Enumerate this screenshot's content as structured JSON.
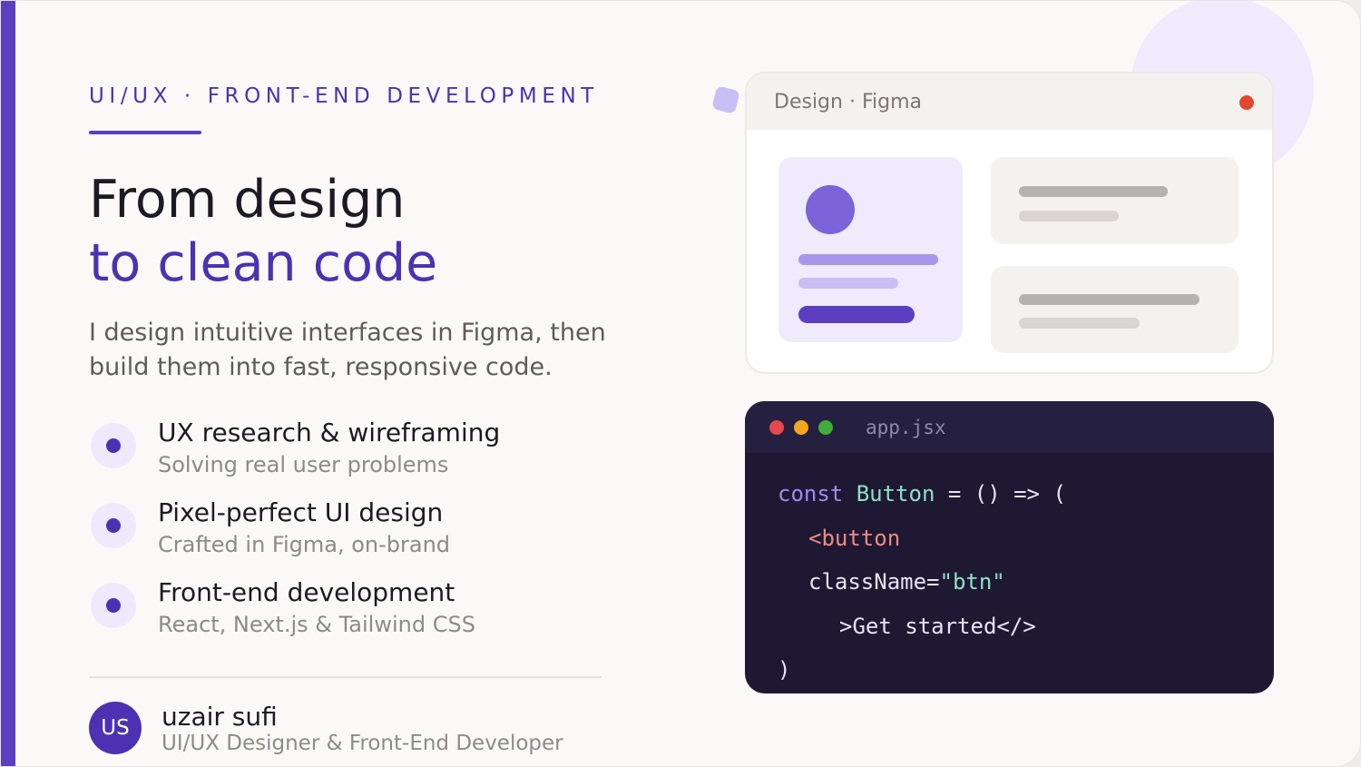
{
  "colors": {
    "accent": "#5b3fc0",
    "accent_text": "#4a32b3",
    "card_background": "#fbf9f8",
    "code_background": "#1e1832",
    "record_dot": "#e0492e"
  },
  "hero": {
    "eyebrow": "UI/UX · FRONT-END DEVELOPMENT",
    "title_line1": "From design",
    "title_line2": "to clean code",
    "lead": "I design intuitive interfaces in Figma, then build them into fast, responsive code."
  },
  "features": [
    {
      "title": "UX research & wireframing",
      "subtitle": "Solving real user problems",
      "icon": "bullet-dot-icon"
    },
    {
      "title": "Pixel-perfect UI design",
      "subtitle": "Crafted in Figma, on-brand",
      "icon": "bullet-dot-icon"
    },
    {
      "title": "Front-end development",
      "subtitle": "React, Next.js & Tailwind CSS",
      "icon": "bullet-dot-icon"
    }
  ],
  "author": {
    "initials": "US",
    "name": "uzair sufi",
    "role": "UI/UX Designer & Front-End Developer"
  },
  "design_window": {
    "title": "Design · Figma",
    "status_icon": "record-dot-icon"
  },
  "code_window": {
    "filename": "app.jsx",
    "window_controls": [
      "close-dot-icon",
      "minimize-dot-icon",
      "maximize-dot-icon"
    ],
    "line1": {
      "keyword": "const",
      "name": "Button",
      "rest": " = () => ("
    },
    "line2": {
      "tag": "<button"
    },
    "line3": {
      "attr": "className=",
      "value": "\"btn\""
    },
    "line4": {
      "text": ">Get started</>"
    },
    "line5": {
      "text": ")"
    }
  }
}
